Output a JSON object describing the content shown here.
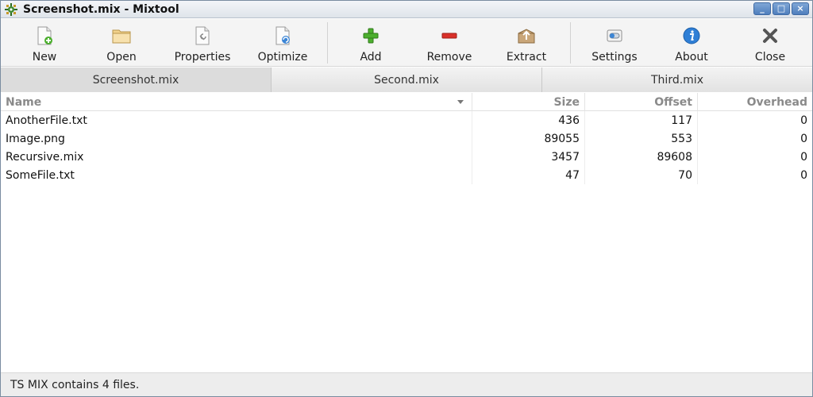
{
  "window": {
    "title": "Screenshot.mix - Mixtool",
    "controls": {
      "minimize": "_",
      "maximize": "□",
      "close": "×"
    }
  },
  "toolbar": {
    "buttons": [
      {
        "label": "New",
        "icon": "new-file-icon"
      },
      {
        "label": "Open",
        "icon": "folder-open-icon"
      },
      {
        "label": "Properties",
        "icon": "properties-icon"
      },
      {
        "label": "Optimize",
        "icon": "optimize-icon"
      },
      {
        "label": "Add",
        "icon": "add-plus-icon"
      },
      {
        "label": "Remove",
        "icon": "remove-minus-icon"
      },
      {
        "label": "Extract",
        "icon": "extract-box-icon"
      },
      {
        "label": "Settings",
        "icon": "settings-toggle-icon"
      },
      {
        "label": "About",
        "icon": "info-icon"
      },
      {
        "label": "Close",
        "icon": "close-x-icon"
      }
    ]
  },
  "tabs": [
    {
      "label": "Screenshot.mix",
      "active": true
    },
    {
      "label": "Second.mix",
      "active": false
    },
    {
      "label": "Third.mix",
      "active": false
    }
  ],
  "table": {
    "columns": {
      "name": "Name",
      "size": "Size",
      "offset": "Offset",
      "overhead": "Overhead"
    },
    "sort_column": "name",
    "rows": [
      {
        "name": "AnotherFile.txt",
        "size": "436",
        "offset": "117",
        "overhead": "0"
      },
      {
        "name": "Image.png",
        "size": "89055",
        "offset": "553",
        "overhead": "0"
      },
      {
        "name": "Recursive.mix",
        "size": "3457",
        "offset": "89608",
        "overhead": "0"
      },
      {
        "name": "SomeFile.txt",
        "size": "47",
        "offset": "70",
        "overhead": "0"
      }
    ]
  },
  "status": {
    "text": "TS MIX contains 4 files."
  },
  "colors": {
    "add_green": "#4caf2e",
    "remove_red": "#d9302a",
    "about_blue": "#2f7fd6",
    "titlebar_button_blue": "#4f7fbd"
  }
}
